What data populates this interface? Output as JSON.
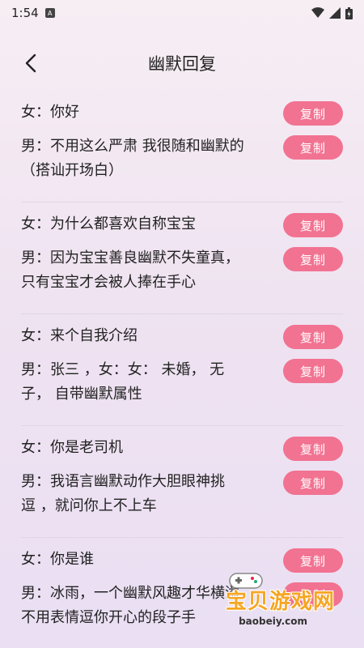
{
  "status_bar": {
    "time": "1:54",
    "notification_glyph": "A"
  },
  "header": {
    "title": "幽默回复"
  },
  "items": [
    {
      "question": "女：你好",
      "answer_lines": [
        "男：不用这么严肃 我很随和幽默的",
        "（搭讪开场白）"
      ]
    },
    {
      "question": "女：为什么都喜欢自称宝宝",
      "answer_lines": [
        "男：因为宝宝善良幽默不失童真，",
        "只有宝宝才会被人捧在手心"
      ]
    },
    {
      "question": "女：来个自我介绍",
      "answer_lines": [
        "男：张三 ，女：女： 未婚， 无",
        "子， 自带幽默属性"
      ]
    },
    {
      "question": "女：你是老司机",
      "answer_lines": [
        "男：我语言幽默动作大胆眼神挑",
        "逗 ，就问你上不上车"
      ]
    },
    {
      "question": "女：你是谁",
      "answer_lines": [
        "男：冰雨，一个幽默风趣才华横溢",
        "不用表情逗你开心的段子手"
      ]
    }
  ],
  "copy_label": "复制",
  "watermark": {
    "title": "宝贝游戏网",
    "url": "baobeiy.com"
  },
  "colors": {
    "accent": "#f27291"
  }
}
